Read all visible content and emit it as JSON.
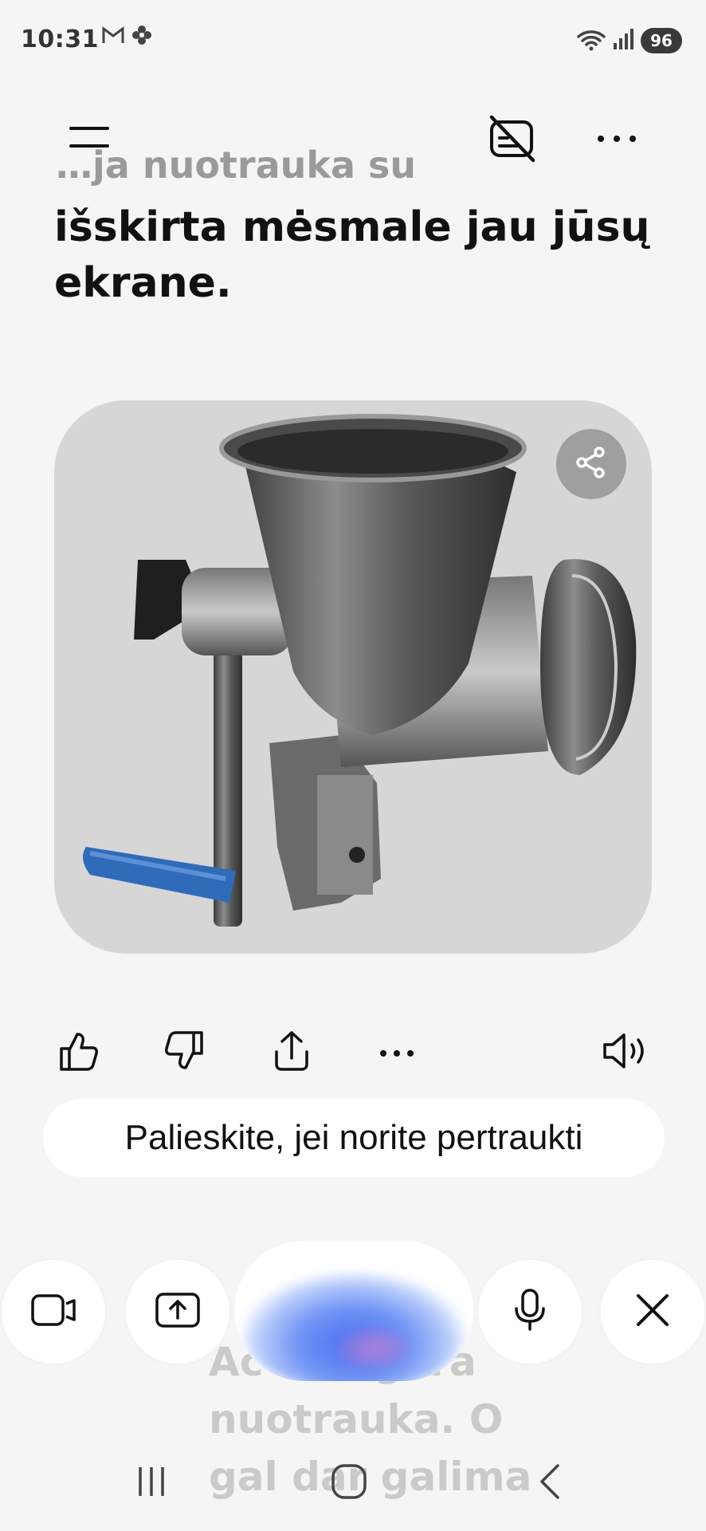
{
  "status_bar": {
    "time": "10:31",
    "battery": "96"
  },
  "heading": {
    "faded_line": "…ja nuotrauka su",
    "main_text": "išskirta mėsmale jau jūsų ekrane."
  },
  "actions": {
    "interrupt_hint": "Palieskite, jei norite pertraukti"
  },
  "background_response": {
    "lines": [
      "Ac        gera",
      "nuotrauka. O",
      "gal dar galima"
    ]
  },
  "colors": {
    "background": "#f5f5f5",
    "card": "#d6d6d6",
    "handle_blue": "#2f6bb8"
  },
  "icons": {
    "menu": "menu-icon",
    "subtitles_off": "subtitles-off-icon",
    "more": "more-icon",
    "share": "share-icon",
    "thumbs_up": "thumbs-up-icon",
    "thumbs_down": "thumbs-down-icon",
    "upload": "upload-icon",
    "speaker": "speaker-icon",
    "camera": "video-camera-icon",
    "screen_share": "screen-share-icon",
    "mic": "microphone-icon",
    "close": "close-icon"
  }
}
